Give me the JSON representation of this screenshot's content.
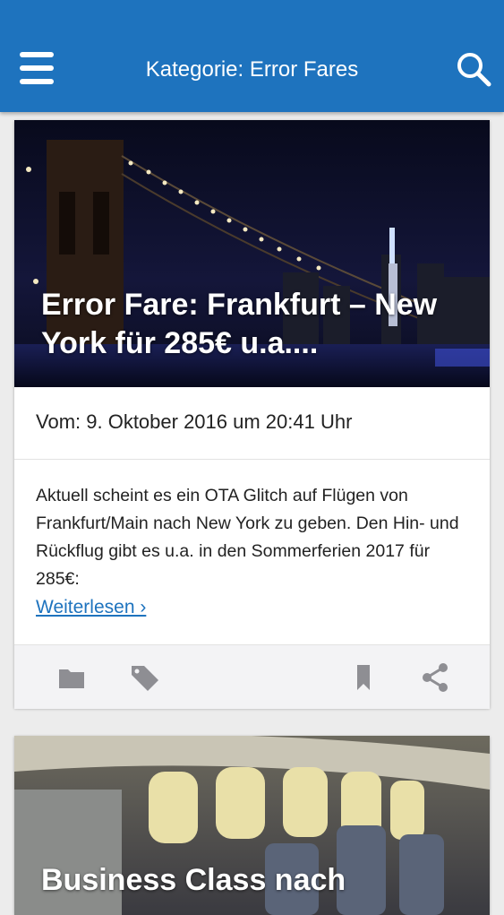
{
  "header": {
    "title": "Kategorie: Error Fares",
    "menu_icon": "hamburger-menu-icon",
    "search_icon": "search-icon",
    "background": "#1e73be"
  },
  "posts": [
    {
      "title": "Error Fare: Frankfurt – New York für 285€ u.a....",
      "meta": "Vom: 9. Oktober 2016 um 20:41 Uhr",
      "excerpt": "Aktuell scheint es ein OTA Glitch auf Flügen von Frankfurt/Main nach New York zu geben. Den Hin- und Rückflug gibt es u.a. in den Sommerferien 2017 für 285€:",
      "read_more": "Weiterlesen ›",
      "actions": [
        "folder-icon",
        "tag-icon",
        "bookmark-icon",
        "share-icon"
      ]
    },
    {
      "title": "Business Class nach"
    }
  ]
}
